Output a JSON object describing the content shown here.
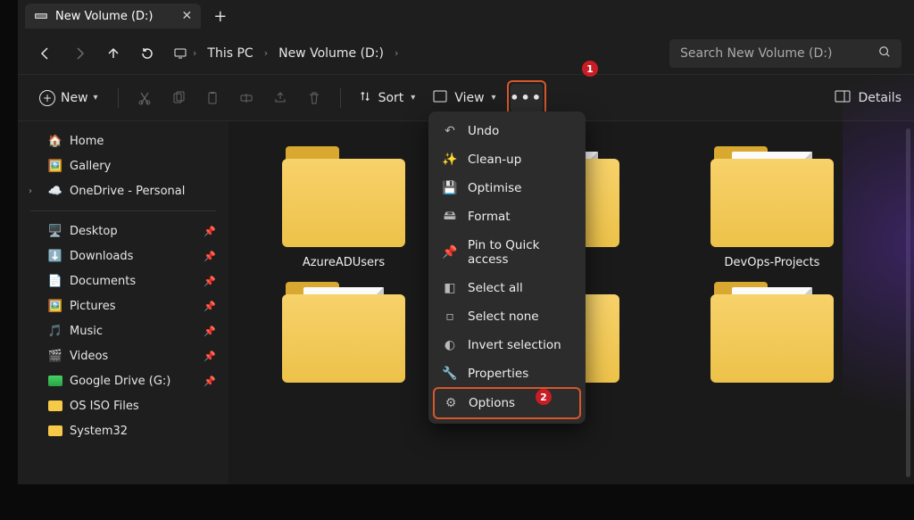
{
  "tab": {
    "title": "New Volume (D:)"
  },
  "breadcrumbs": {
    "a": "This PC",
    "b": "New Volume (D:)"
  },
  "search": {
    "placeholder": "Search New Volume (D:)"
  },
  "toolbar": {
    "new": "New",
    "sort": "Sort",
    "view": "View",
    "details": "Details"
  },
  "sidebar": {
    "home": "Home",
    "gallery": "Gallery",
    "onedrive": "OneDrive - Personal",
    "desktop": "Desktop",
    "downloads": "Downloads",
    "documents": "Documents",
    "pictures": "Pictures",
    "music": "Music",
    "videos": "Videos",
    "gdrive": "Google Drive (G:)",
    "osiso": "OS ISO Files",
    "system32": "System32"
  },
  "folders": {
    "f1": "AzureADUsers",
    "f2": "",
    "f3": "DevOps-Projects",
    "f4": "",
    "f5": "",
    "f6": ""
  },
  "context_menu": {
    "undo": "Undo",
    "cleanup": "Clean-up",
    "optimise": "Optimise",
    "format": "Format",
    "pin": "Pin to Quick access",
    "select_all": "Select all",
    "select_none": "Select none",
    "invert": "Invert selection",
    "properties": "Properties",
    "options": "Options"
  },
  "annotations": {
    "a1": "1",
    "a2": "2"
  }
}
